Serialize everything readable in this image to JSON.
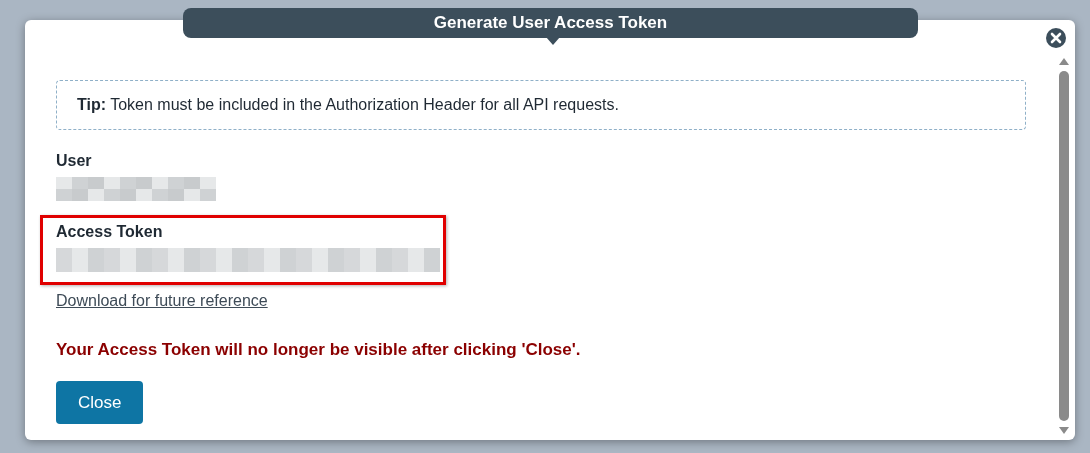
{
  "dialog": {
    "title": "Generate User Access Token",
    "tip": {
      "label": "Tip:",
      "text": "Token must be included in the Authorization Header for all API requests."
    },
    "fields": [
      {
        "label": "User",
        "highlighted": false
      },
      {
        "label": "Access Token",
        "highlighted": true
      }
    ],
    "download_link": "Download for future reference",
    "warning": "Your Access Token will no longer be visible after clicking 'Close'.",
    "buttons": [
      "Close"
    ]
  }
}
